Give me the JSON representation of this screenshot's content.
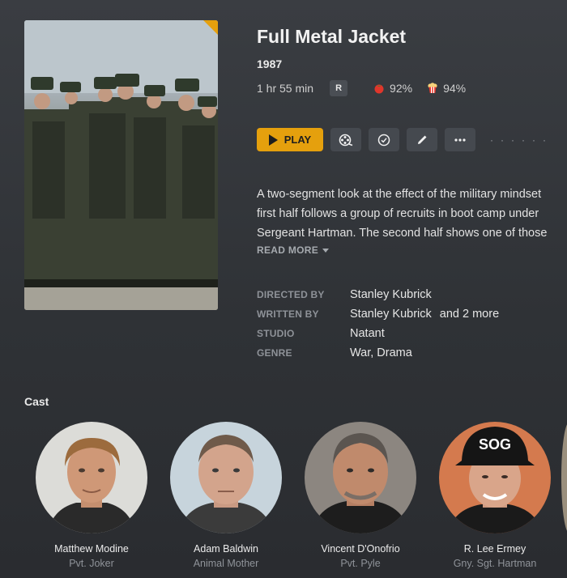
{
  "movie": {
    "title": "Full Metal Jacket",
    "year": "1987",
    "duration": "1 hr 55 min",
    "content_rating": "R",
    "critic_score": "92%",
    "audience_score": "94%",
    "accent_color": "#e5a00d"
  },
  "toolbar": {
    "play_label": "PLAY",
    "icons": [
      "play-icon",
      "film-reel-icon",
      "check-circle-icon",
      "pencil-icon",
      "more-icon"
    ]
  },
  "summary": {
    "lines": [
      "A two-segment look at the effect of the military mindset",
      "first half follows a group of recruits in boot camp under",
      "Sergeant Hartman. The second half shows one of those"
    ],
    "read_more": "READ MORE"
  },
  "credits": {
    "directed_by_label": "DIRECTED BY",
    "directed_by": "Stanley Kubrick",
    "written_by_label": "WRITTEN BY",
    "written_by": "Stanley Kubrick",
    "written_by_more": "and 2 more",
    "studio_label": "STUDIO",
    "studio": "Natant",
    "genre_label": "GENRE",
    "genre": "War, Drama"
  },
  "cast": {
    "title": "Cast",
    "members": [
      {
        "name": "Matthew Modine",
        "role": "Pvt. Joker"
      },
      {
        "name": "Adam Baldwin",
        "role": "Animal Mother"
      },
      {
        "name": "Vincent D'Onofrio",
        "role": "Pvt. Pyle"
      },
      {
        "name": "R. Lee Ermey",
        "role": "Gny. Sgt. Hartman"
      }
    ],
    "cap_text": "SOG"
  }
}
